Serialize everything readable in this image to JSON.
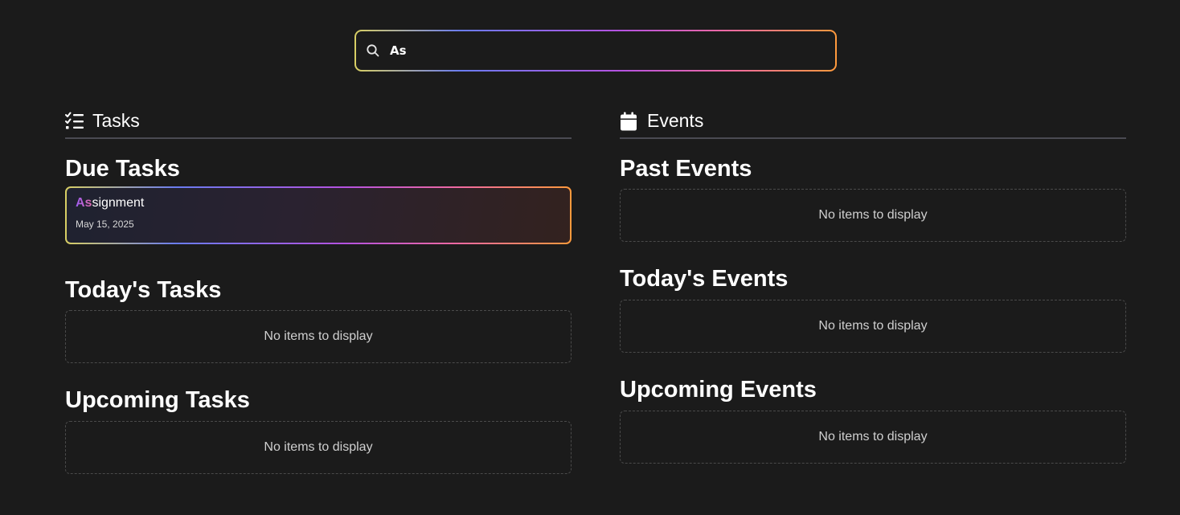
{
  "search": {
    "value": "As",
    "icon": "search-icon"
  },
  "tasks": {
    "header": "Tasks",
    "icon": "checklist-icon",
    "due": {
      "title": "Due Tasks",
      "items": [
        {
          "name_highlight": "As",
          "name_rest": "signment",
          "date": "May 15, 2025"
        }
      ]
    },
    "today": {
      "title": "Today's Tasks",
      "empty": "No items to display"
    },
    "upcoming": {
      "title": "Upcoming Tasks",
      "empty": "No items to display"
    }
  },
  "events": {
    "header": "Events",
    "icon": "calendar-icon",
    "past": {
      "title": "Past Events",
      "empty": "No items to display"
    },
    "today": {
      "title": "Today's Events",
      "empty": "No items to display"
    },
    "upcoming": {
      "title": "Upcoming Events",
      "empty": "No items to display"
    }
  },
  "colors": {
    "background": "#1b1b1b",
    "gradient": [
      "#d8cf63",
      "#6a7cf0",
      "#b452e0",
      "#f06aa0",
      "#ff9a3c"
    ]
  }
}
